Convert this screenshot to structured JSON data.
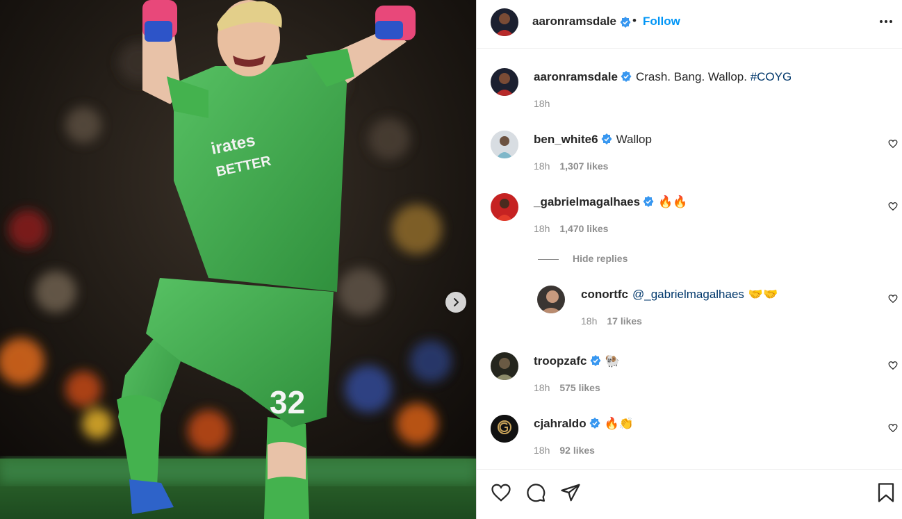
{
  "post": {
    "author": "aaronramsdale",
    "follow_label": "Follow",
    "separator": "•",
    "caption": "Crash. Bang. Wallop.",
    "hashtag": "#COYG",
    "time": "18h",
    "jersey_number": "32"
  },
  "comments": [
    {
      "user": "ben_white6",
      "verified": true,
      "text": "Wallop",
      "time": "18h",
      "likes": "1,307 likes"
    },
    {
      "user": "_gabrielmagalhaes",
      "verified": true,
      "text": "🔥🔥",
      "time": "18h",
      "likes": "1,470 likes"
    },
    {
      "user": "troopzafc",
      "verified": true,
      "text": "🐏",
      "time": "18h",
      "likes": "575 likes"
    },
    {
      "user": "cjahraldo",
      "verified": true,
      "text": "🔥👏",
      "time": "18h",
      "likes": "92 likes"
    }
  ],
  "replies": {
    "toggle_label": "Hide replies",
    "items": [
      {
        "user": "conortfc",
        "mention": "@_gabrielmagalhaes",
        "text": "🤝🤝",
        "time": "18h",
        "likes": "17 likes"
      }
    ]
  },
  "icons": {
    "verified": "verified-badge-icon",
    "more": "more-options-icon",
    "heart": "heart-icon",
    "comment": "comment-icon",
    "share": "share-icon",
    "save": "bookmark-icon",
    "next": "chevron-right-icon"
  },
  "colors": {
    "accent": "#0095f6",
    "link": "#00376b",
    "muted": "#8e8e8e",
    "kit": "#3fa34d"
  }
}
